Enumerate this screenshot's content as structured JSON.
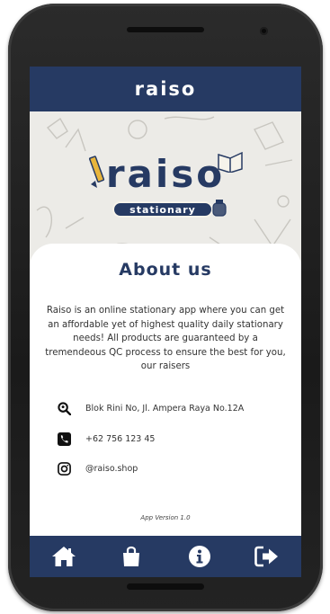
{
  "app": {
    "title": "raiso",
    "colors": {
      "primary": "#263a63",
      "banner_bg": "#ecebe7",
      "text": "#333333"
    }
  },
  "banner": {
    "logo_word": "raiso",
    "logo_subtitle": "stationary",
    "icons": [
      "pencil-icon",
      "book-icon",
      "ink-bottle-icon"
    ]
  },
  "about": {
    "title": "About us",
    "description": "Raiso is an online stationary app where you can get an affordable yet of highest quality daily stationary needs! All products are guaranteed by a tremendeous QC process to ensure the best for you, our raisers"
  },
  "contacts": [
    {
      "icon": "location-search-icon",
      "text": "Blok Rini No, Jl. Ampera Raya No.12A"
    },
    {
      "icon": "phone-icon",
      "text": "+62 756 123 45"
    },
    {
      "icon": "instagram-icon",
      "text": "@raiso.shop"
    }
  ],
  "footer": {
    "version": "App Version 1.0"
  },
  "nav": [
    {
      "name": "home",
      "icon": "home-icon"
    },
    {
      "name": "shop",
      "icon": "shopping-bag-icon"
    },
    {
      "name": "info",
      "icon": "info-icon"
    },
    {
      "name": "logout",
      "icon": "logout-icon"
    }
  ]
}
